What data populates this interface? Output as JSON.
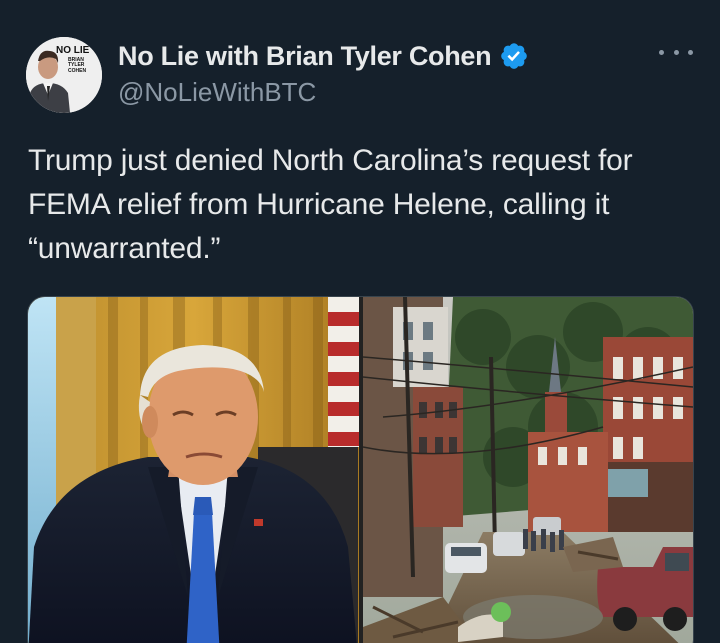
{
  "author": {
    "display_name": "No Lie with Brian Tyler Cohen",
    "handle": "@NoLieWithBTC",
    "verified": true,
    "avatar_logo": {
      "line1": "NO LIE",
      "line2": "BRIAN TYLER COHEN"
    }
  },
  "tweet": {
    "text": "Trump just denied North Carolina’s request for FEMA relief from Hurricane Helene, calling it “unwarranted.”"
  },
  "media": {
    "count": 2,
    "items": [
      {
        "subject": "portrait-photo"
      },
      {
        "subject": "flood-damaged-street-photo"
      }
    ]
  },
  "colors": {
    "background": "#15202b",
    "text": "#e7e9ea",
    "secondary_text": "#8b98a5",
    "verified_badge": "#1d9bf0"
  },
  "icons": {
    "verified": "verified-badge-icon",
    "more": "more-options-icon"
  }
}
